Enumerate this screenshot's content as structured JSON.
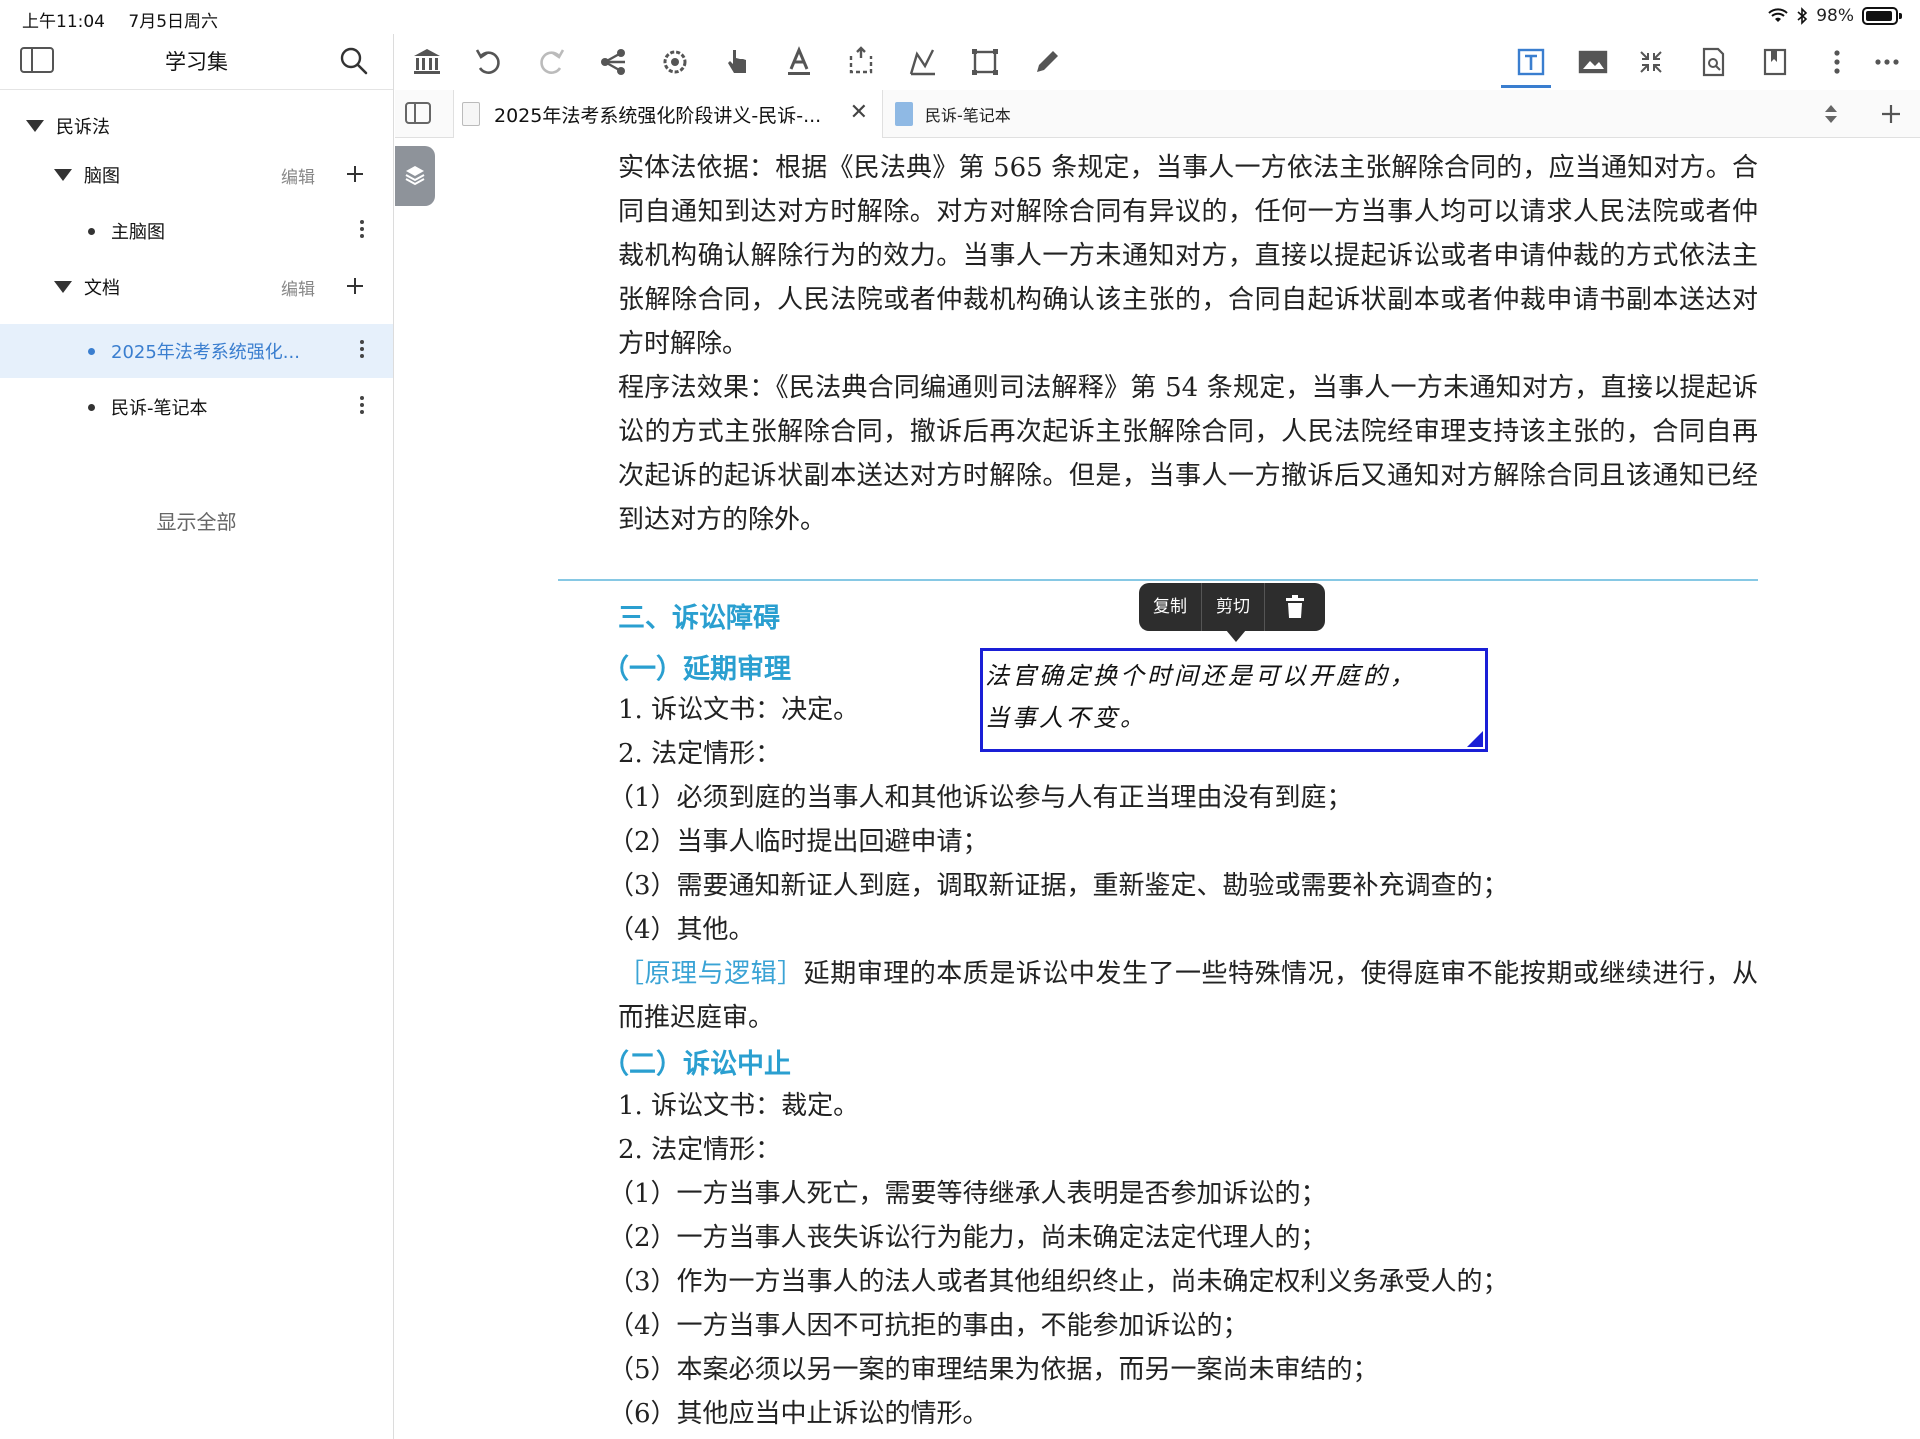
{
  "status": {
    "time": "上午11:04",
    "date": "7月5日周六",
    "battery": "98%"
  },
  "sidebar": {
    "title": "学习集",
    "root": "民诉法",
    "groups": [
      {
        "label": "脑图",
        "edit": "编辑",
        "items": [
          "主脑图"
        ]
      },
      {
        "label": "文档",
        "edit": "编辑",
        "items": [
          "2025年法考系统强化...",
          "民诉-笔记本"
        ]
      }
    ],
    "show_all": "显示全部"
  },
  "tabs": {
    "active": "2025年法考系统强化阶段讲义-民诉-...",
    "close": "✕",
    "second": "民诉-笔记本"
  },
  "popup": {
    "copy": "复制",
    "cut": "剪切"
  },
  "textbox": {
    "line1": "法官确定换个时间还是可以开庭的，",
    "line2": "当事人不变。"
  },
  "document": {
    "para1": "实体法依据：根据《民法典》第 565 条规定，当事人一方依法主张解除合同的，应当通知对方。合同自通知到达对方时解除。对方对解除合同有异议的，任何一方当事人均可以请求人民法院或者仲裁机构确认解除行为的效力。当事人一方未通知对方，直接以提起诉讼或者申请仲裁的方式依法主张解除合同，人民法院或者仲裁机构确认该主张的，合同自起诉状副本或者仲裁申请书副本送达对方时解除。",
    "para2": "程序法效果：《民法典合同编通则司法解释》第 54 条规定，当事人一方未通知对方，直接以提起诉讼的方式主张解除合同，撤诉后再次起诉主张解除合同，人民法院经审理支持该主张的，合同自再次起诉的起诉状副本送达对方时解除。但是，当事人一方撤诉后又通知对方解除合同且该通知已经到达对方的除外。",
    "section3": "三、诉讼障碍",
    "sub1": "（一）延期审理",
    "s1_l1": "1. 诉讼文书：决定。",
    "s1_l2": "2. 法定情形：",
    "s1_items": [
      "（1）必须到庭的当事人和其他诉讼参与人有正当理由没有到庭；",
      "（2）当事人临时提出回避申请；",
      "（3）需要通知新证人到庭，调取新证据，重新鉴定、勘验或需要补充调查的；",
      "（4）其他。"
    ],
    "principle_tag": "［原理与逻辑］",
    "principle_text": "延期审理的本质是诉讼中发生了一些特殊情况，使得庭审不能按期或继续进行，从而推迟庭审。",
    "sub2": "（二）诉讼中止",
    "s2_l1": "1. 诉讼文书：裁定。",
    "s2_l2": "2. 法定情形：",
    "s2_items": [
      "（1）一方当事人死亡，需要等待继承人表明是否参加诉讼的；",
      "（2）一方当事人丧失诉讼行为能力，尚未确定法定代理人的；",
      "（3）作为一方当事人的法人或者其他组织终止，尚未确定权利义务承受人的；",
      "（4）一方当事人因不可抗拒的事由，不能参加诉讼的；",
      "（5）本案必须以另一案的审理结果为依据，而另一案尚未审结的；",
      "（6）其他应当中止诉讼的情形。"
    ]
  },
  "colors": {
    "accent": "#3a7ecf",
    "heading": "#2a9fd0",
    "textbox_border": "#1a1fd6"
  },
  "toolbar_icons": [
    "library-icon",
    "undo-icon",
    "redo-icon",
    "share-icon",
    "settings-gear-icon",
    "hand-icon",
    "text-color-icon",
    "crop-icon",
    "shape-icon",
    "selection-rect-icon",
    "pen-icon",
    "textbox-icon",
    "image-icon",
    "collapse-icon",
    "search-doc-icon",
    "bookmark-icon",
    "more-vertical-icon",
    "more-horizontal-icon"
  ]
}
